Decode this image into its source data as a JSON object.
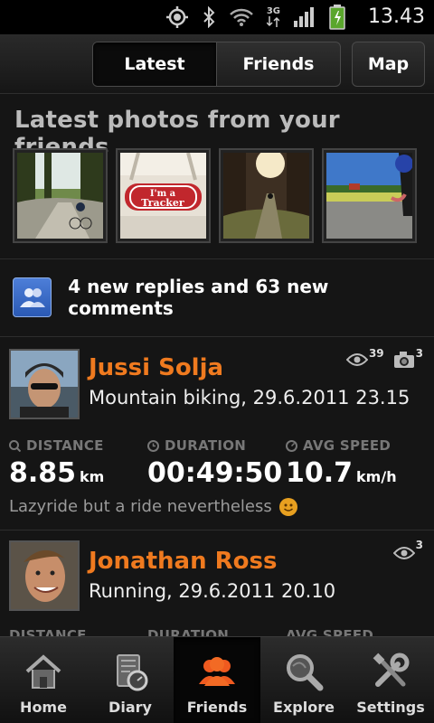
{
  "status_bar": {
    "clock": "13.43",
    "network": "3G",
    "icons": [
      "gps-icon",
      "bluetooth-icon",
      "wifi-icon",
      "signal-icon",
      "battery-icon"
    ]
  },
  "tabs": {
    "latest": "Latest",
    "friends": "Friends",
    "map": "Map"
  },
  "photos": {
    "title": "Latest photos from your friends",
    "items": [
      "photo-forest-ride",
      "photo-im-a-tracker",
      "photo-sunlit-trail",
      "photo-road-field"
    ],
    "tracker_text_1": "I'm a",
    "tracker_text_2": "Tracker"
  },
  "notification": {
    "text": "4 new replies and 63 new comments"
  },
  "activities": [
    {
      "name": "Jussi Solja",
      "sport": "Mountain biking, 29.6.2011 23.15",
      "views": "39",
      "photos": "3",
      "distance_label": "DISTANCE",
      "distance_value": "8.85",
      "distance_unit": "km",
      "duration_label": "DURATION",
      "duration_value": "00:49:50",
      "speed_label": "AVG SPEED",
      "speed_value": "10.7",
      "speed_unit": "km/h",
      "note": "Lazyride but a ride nevertheless"
    },
    {
      "name": "Jonathan Ross",
      "sport": "Running, 29.6.2011 20.10",
      "views": "3",
      "distance_label": "DISTANCE",
      "duration_label": "DURATION",
      "speed_label": "AVG SPEED"
    }
  ],
  "bottom_nav": [
    {
      "label": "Home",
      "icon": "home-icon"
    },
    {
      "label": "Diary",
      "icon": "diary-icon"
    },
    {
      "label": "Friends",
      "icon": "friends-icon",
      "active": true
    },
    {
      "label": "Explore",
      "icon": "explore-icon"
    },
    {
      "label": "Settings",
      "icon": "settings-icon"
    }
  ],
  "colors": {
    "accent": "#ef7a1f",
    "background": "#151515",
    "notice_blue": "#3b6cc8"
  }
}
